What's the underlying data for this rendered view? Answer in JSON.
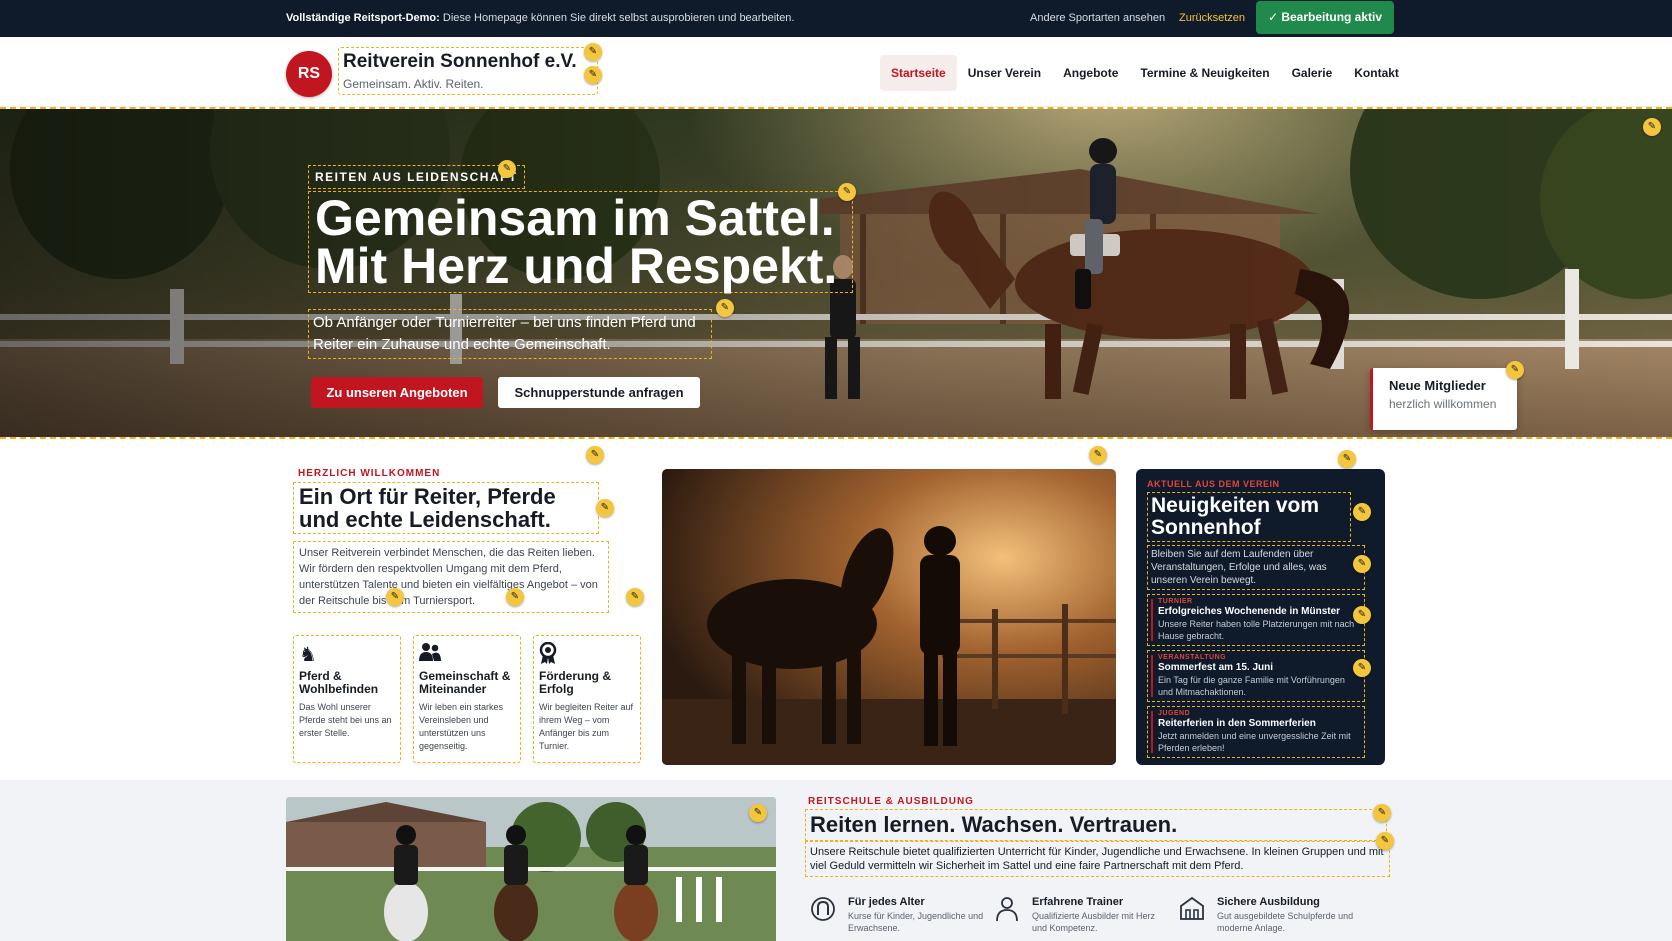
{
  "demo_bar": {
    "label_bold": "Vollständige Reitsport-Demo:",
    "message": " Diese Homepage können Sie direkt selbst ausprobieren und bearbeiten.",
    "other_sports": "Andere Sportarten ansehen",
    "reset": "Zurücksetzen",
    "editing_active": "✓ Bearbeitung aktiv"
  },
  "header": {
    "logo_initials": "RS",
    "club_name": "Reitverein Sonnenhof e.V.",
    "tagline": "Gemeinsam. Aktiv. Reiten.",
    "nav": [
      "Startseite",
      "Unser Verein",
      "Angebote",
      "Termine & Neuigkeiten",
      "Galerie",
      "Kontakt"
    ],
    "active_nav": "Startseite"
  },
  "hero": {
    "eyebrow": "REITEN AUS LEIDENSCHAFT",
    "headline_line1": "Gemeinsam im Sattel.",
    "headline_line2": "Mit Herz und Respekt.",
    "subline": "Ob Anfänger oder Turnierreiter – bei uns finden Pferd und Reiter ein Zuhause und echte Gemeinschaft.",
    "cta_primary": "Zu unseren Angeboten",
    "cta_secondary": "Schnupperstunde anfragen",
    "badge_title": "Neue Mitglieder",
    "badge_sub": "herzlich willkommen"
  },
  "welcome": {
    "eyebrow": "HERZLICH WILLKOMMEN",
    "title": "Ein Ort für Reiter, Pferde und echte Leidenschaft.",
    "text": "Unser Reitverein verbindet Menschen, die das Reiten lieben. Wir fördern den respektvollen Umgang mit dem Pferd, unterstützen Talente und bieten ein vielfältiges Angebot – von der Reitschule bis zum Turniersport.",
    "features": [
      {
        "icon": "horse-head-icon",
        "title": "Pferd & Wohlbefinden",
        "text": "Das Wohl unserer Pferde steht bei uns an erster Stelle."
      },
      {
        "icon": "group-icon",
        "title": "Gemeinschaft & Miteinander",
        "text": "Wir leben ein starkes Vereinsleben und unterstützen uns gegenseitig."
      },
      {
        "icon": "award-icon",
        "title": "Förderung & Erfolg",
        "text": "Wir begleiten Reiter auf ihrem Weg – vom Anfänger bis zum Turnier."
      }
    ]
  },
  "news": {
    "eyebrow": "AKTUELL AUS DEM VEREIN",
    "title": "Neuigkeiten vom Sonnenhof",
    "intro": "Bleiben Sie auf dem Laufenden über Veranstaltungen, Erfolge und alles, was unseren Verein bewegt.",
    "items": [
      {
        "category": "TURNIER",
        "title": "Erfolgreiches Wochenende in Münster",
        "text": "Unsere Reiter haben tolle Platzierungen mit nach Hause gebracht."
      },
      {
        "category": "VERANSTALTUNG",
        "title": "Sommerfest am 15. Juni",
        "text": "Ein Tag für die ganze Familie mit Vorführungen und Mitmachaktionen."
      },
      {
        "category": "JUGEND",
        "title": "Reiterferien in den Sommerferien",
        "text": "Jetzt anmelden und eine unvergessliche Zeit mit Pferden erleben!"
      }
    ]
  },
  "school": {
    "eyebrow": "REITSCHULE & AUSBILDUNG",
    "title": "Reiten lernen. Wachsen. Vertrauen.",
    "text": "Unsere Reitschule bietet qualifizierten Unterricht für Kinder, Jugendliche und Erwachsene. In kleinen Gruppen und mit viel Geduld vermitteln wir Sicherheit im Sattel und eine faire Partnerschaft mit dem Pferd.",
    "features": [
      {
        "icon": "horseshoe-icon",
        "title": "Für jedes Alter",
        "text": "Kurse für Kinder, Jugendliche und Erwachsene."
      },
      {
        "icon": "trainer-icon",
        "title": "Erfahrene Trainer",
        "text": "Qualifizierte Ausbilder mit Herz und Kompetenz."
      },
      {
        "icon": "stable-icon",
        "title": "Sichere Ausbildung",
        "text": "Gut ausgebildete Schulpferde und moderne Anlage."
      }
    ]
  },
  "colors": {
    "brand_red": "#c1151f",
    "navy": "#0f1a2a",
    "edit_yellow": "#f3c63d",
    "success_green": "#1f8a4c"
  }
}
